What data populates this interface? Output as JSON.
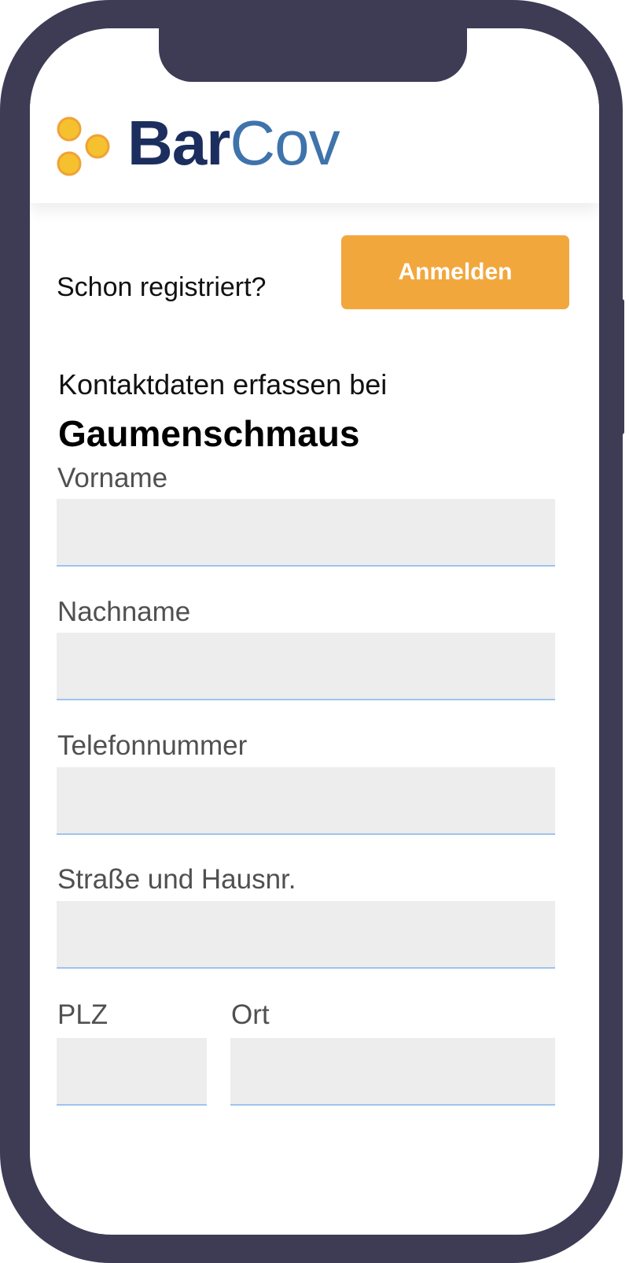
{
  "colors": {
    "frame": "#3e3b55",
    "accent": "#f2a73d",
    "brand_primary": "#1c2e5e",
    "brand_secondary": "#3f73ab",
    "logo_dots": "#f5c12f",
    "logo_dot_outline": "#f0a237",
    "input_background": "#ededed",
    "input_underline": "#9ec4ee"
  },
  "header": {
    "logo_icon": "barcov-dots-logo",
    "logo_text_bold": "Bar",
    "logo_text_light": "Cov"
  },
  "login": {
    "prompt": "Schon registriert?",
    "button_label": "Anmelden"
  },
  "form": {
    "intro": "Kontaktdaten erfassen bei",
    "venue": "Gaumenschmaus",
    "fields": {
      "firstname": {
        "label": "Vorname",
        "value": ""
      },
      "lastname": {
        "label": "Nachname",
        "value": ""
      },
      "phone": {
        "label": "Telefonnummer",
        "value": ""
      },
      "street": {
        "label": "Straße und Hausnr.",
        "value": ""
      },
      "zip": {
        "label": "PLZ",
        "value": ""
      },
      "city": {
        "label": "Ort",
        "value": ""
      }
    }
  }
}
